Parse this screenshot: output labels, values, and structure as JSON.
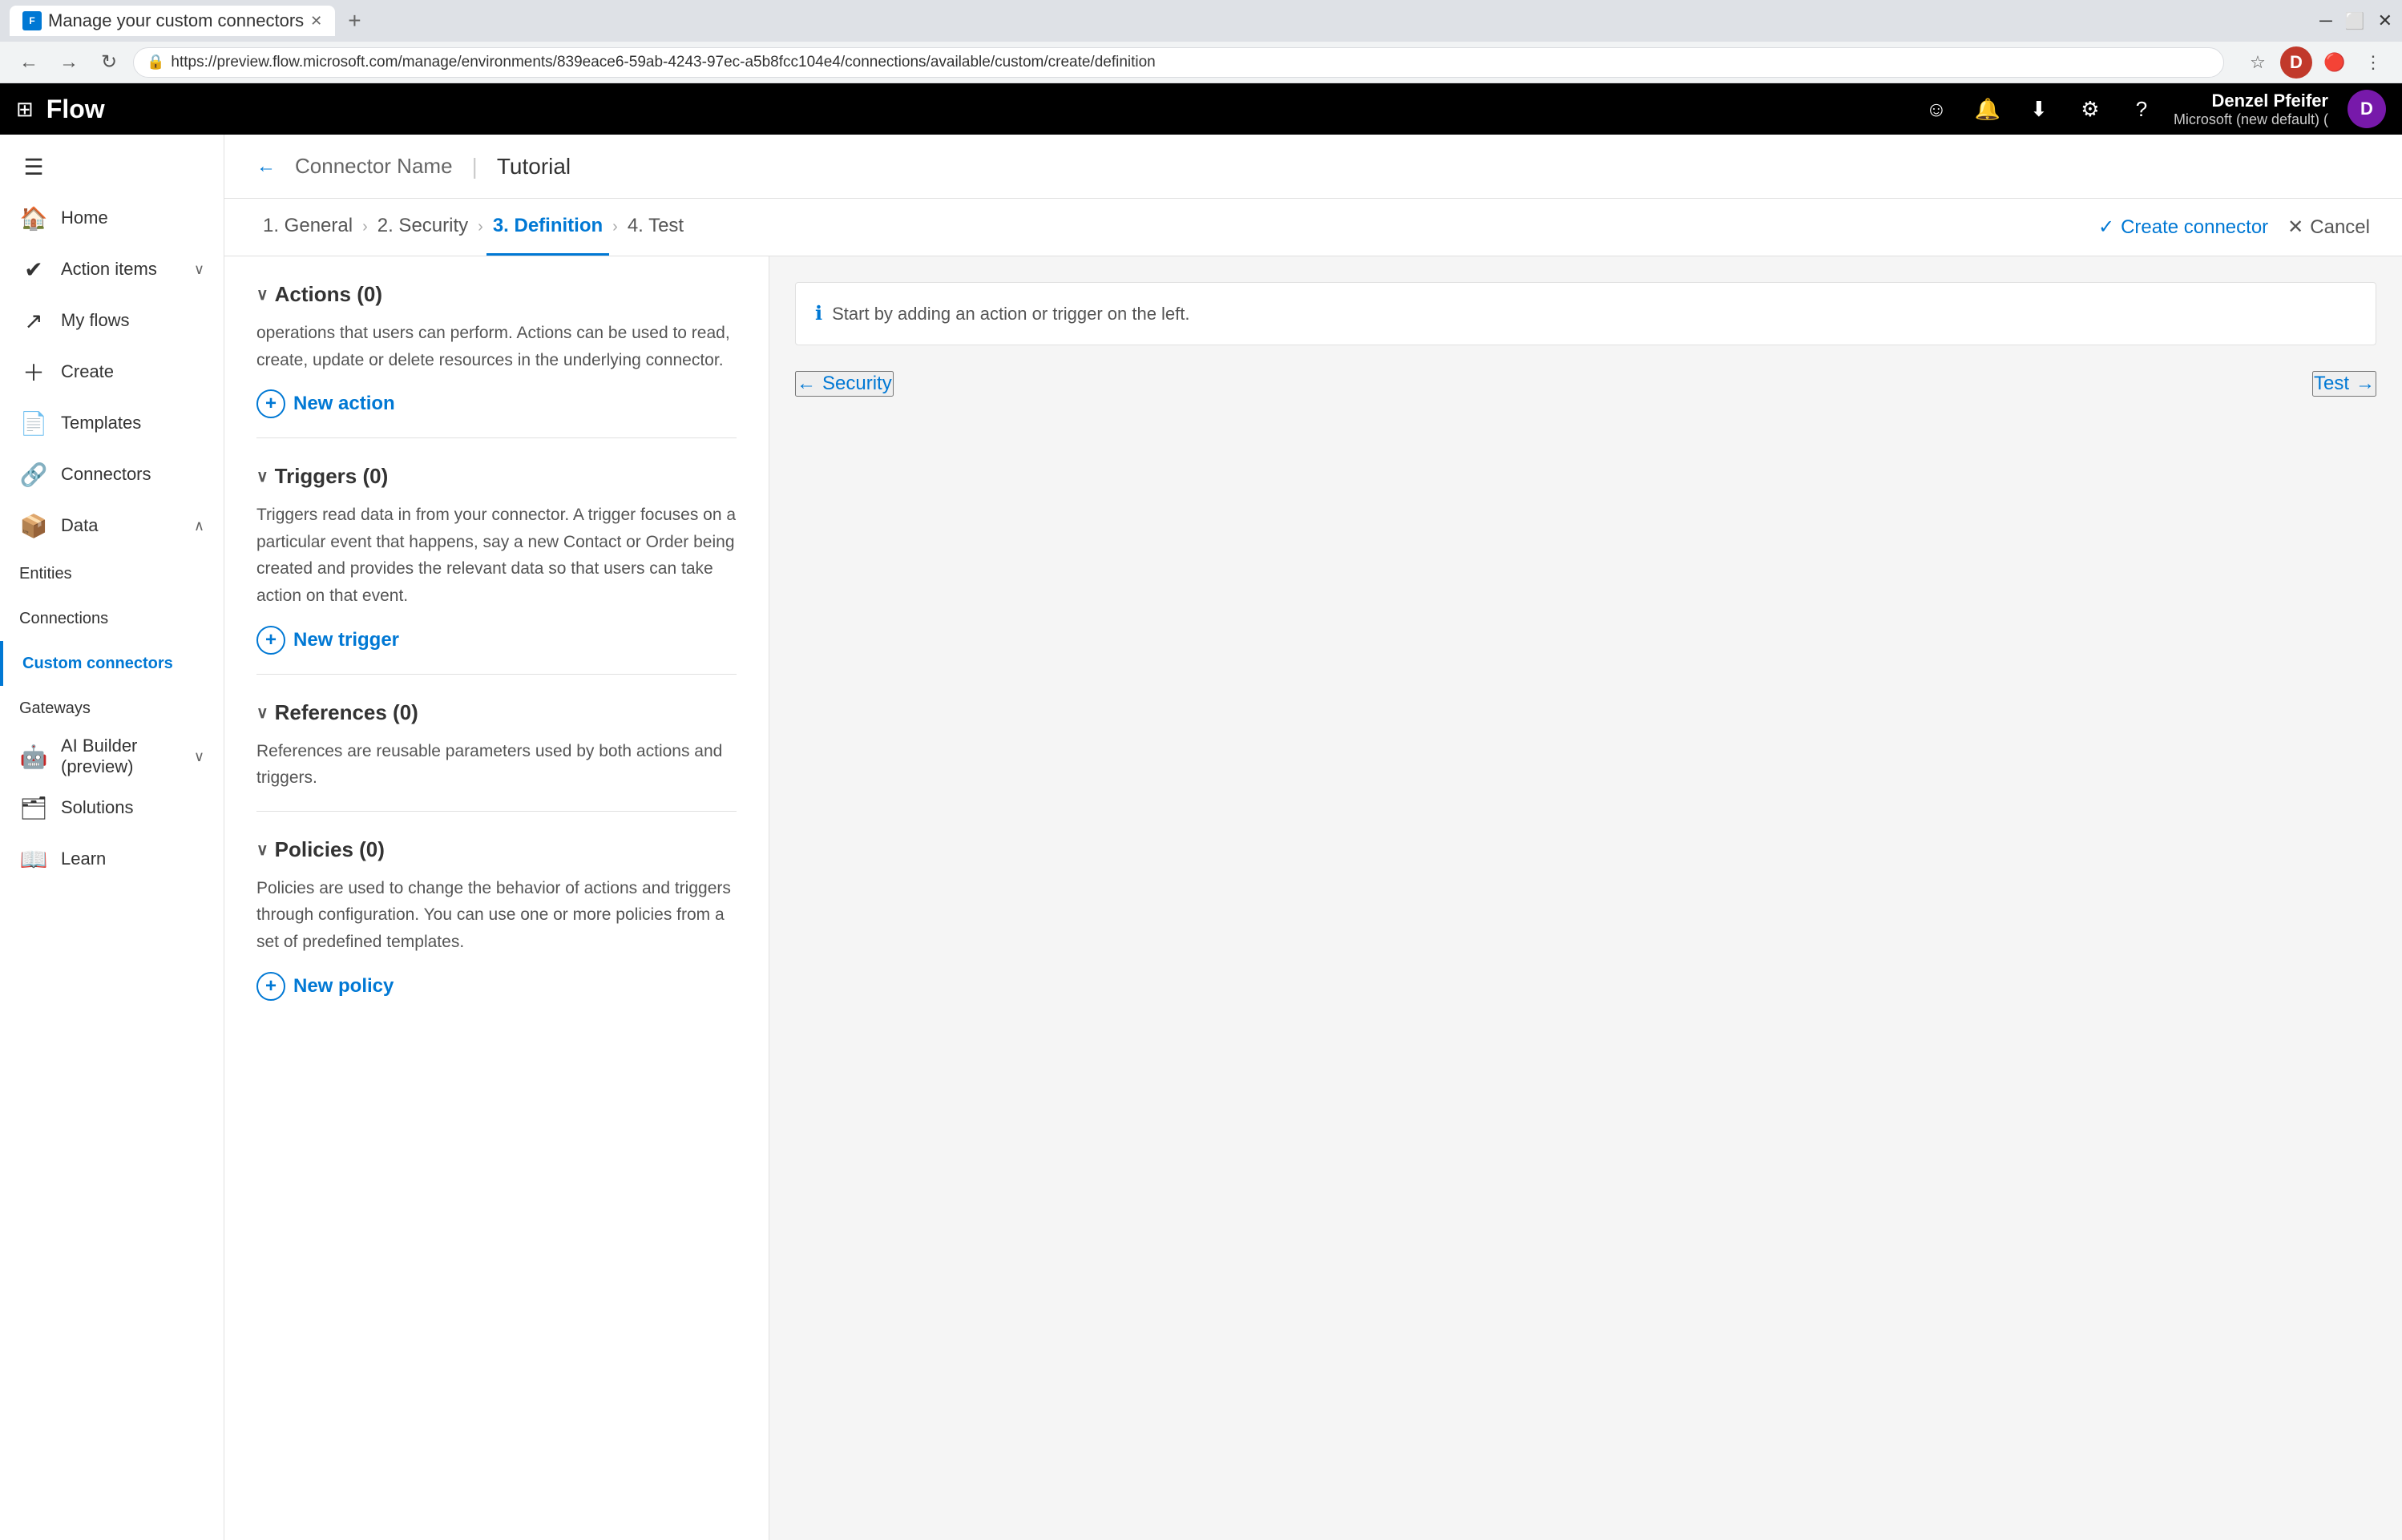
{
  "browser": {
    "tab_title": "Manage your custom connectors",
    "tab_new": "+",
    "address": "https://preview.flow.microsoft.com/manage/environments/839eace6-59ab-4243-97ec-a5b8fcc104e4/connections/available/custom/create/definition",
    "nav_back": "←",
    "nav_forward": "→",
    "nav_refresh": "↻"
  },
  "appbar": {
    "waffle_icon": "⊞",
    "logo": "Flow",
    "icons": [
      "☺",
      "🔔",
      "⬇",
      "⚙",
      "?"
    ],
    "user_name": "Denzel Pfeifer",
    "user_org": "Microsoft (new default) (",
    "user_initial": "D"
  },
  "sidebar": {
    "menu_icon": "☰",
    "items": [
      {
        "id": "home",
        "label": "Home",
        "icon": "🏠",
        "has_chevron": false
      },
      {
        "id": "action-items",
        "label": "Action items",
        "icon": "✓",
        "has_chevron": true
      },
      {
        "id": "my-flows",
        "label": "My flows",
        "icon": "↗",
        "has_chevron": false
      },
      {
        "id": "create",
        "label": "Create",
        "icon": "+",
        "has_chevron": false
      },
      {
        "id": "templates",
        "label": "Templates",
        "icon": "📄",
        "has_chevron": false
      },
      {
        "id": "connectors",
        "label": "Connectors",
        "icon": "🔗",
        "has_chevron": false
      },
      {
        "id": "data",
        "label": "Data",
        "icon": "📦",
        "has_chevron": true
      },
      {
        "id": "entities",
        "label": "Entities",
        "sub": true
      },
      {
        "id": "connections",
        "label": "Connections",
        "sub": true
      },
      {
        "id": "custom-connectors",
        "label": "Custom connectors",
        "sub": true,
        "active": true
      },
      {
        "id": "gateways",
        "label": "Gateways",
        "sub": true
      },
      {
        "id": "ai-builder",
        "label": "AI Builder (preview)",
        "icon": "🤖",
        "has_chevron": true
      },
      {
        "id": "solutions",
        "label": "Solutions",
        "icon": "🗂",
        "has_chevron": false
      },
      {
        "id": "learn",
        "label": "Learn",
        "icon": "📖",
        "has_chevron": false
      }
    ]
  },
  "content_header": {
    "back_arrow": "←",
    "connector_name": "Connector Name",
    "separator": "|",
    "tutorial_label": "Tutorial"
  },
  "wizard": {
    "steps": [
      {
        "id": "general",
        "label": "1. General",
        "active": false
      },
      {
        "id": "security",
        "label": "2. Security",
        "active": false
      },
      {
        "id": "definition",
        "label": "3. Definition",
        "active": true
      },
      {
        "id": "test",
        "label": "4. Test",
        "active": false
      }
    ],
    "create_connector": "Create connector",
    "cancel": "Cancel",
    "check_icon": "✓",
    "close_icon": "✕"
  },
  "left_panel": {
    "actions_section": {
      "header": "Actions (0)",
      "description": "operations that users can perform. Actions can be used to read, create, update or delete resources in the underlying connector.",
      "new_action_label": "New action"
    },
    "triggers_section": {
      "header": "Triggers (0)",
      "description": "Triggers read data in from your connector. A trigger focuses on a particular event that happens, say a new Contact or Order being created and provides the relevant data so that users can take action on that event.",
      "new_trigger_label": "New trigger"
    },
    "references_section": {
      "header": "References (0)",
      "description": "References are reusable parameters used by both actions and triggers."
    },
    "policies_section": {
      "header": "Policies (0)",
      "description": "Policies are used to change the behavior of actions and triggers through configuration. You can use one or more policies from a set of predefined templates.",
      "new_policy_label": "New policy"
    }
  },
  "right_panel": {
    "info_message": "Start by adding an action or trigger on the left.",
    "info_icon": "ℹ",
    "nav_security": "← Security",
    "nav_test": "Test →"
  }
}
